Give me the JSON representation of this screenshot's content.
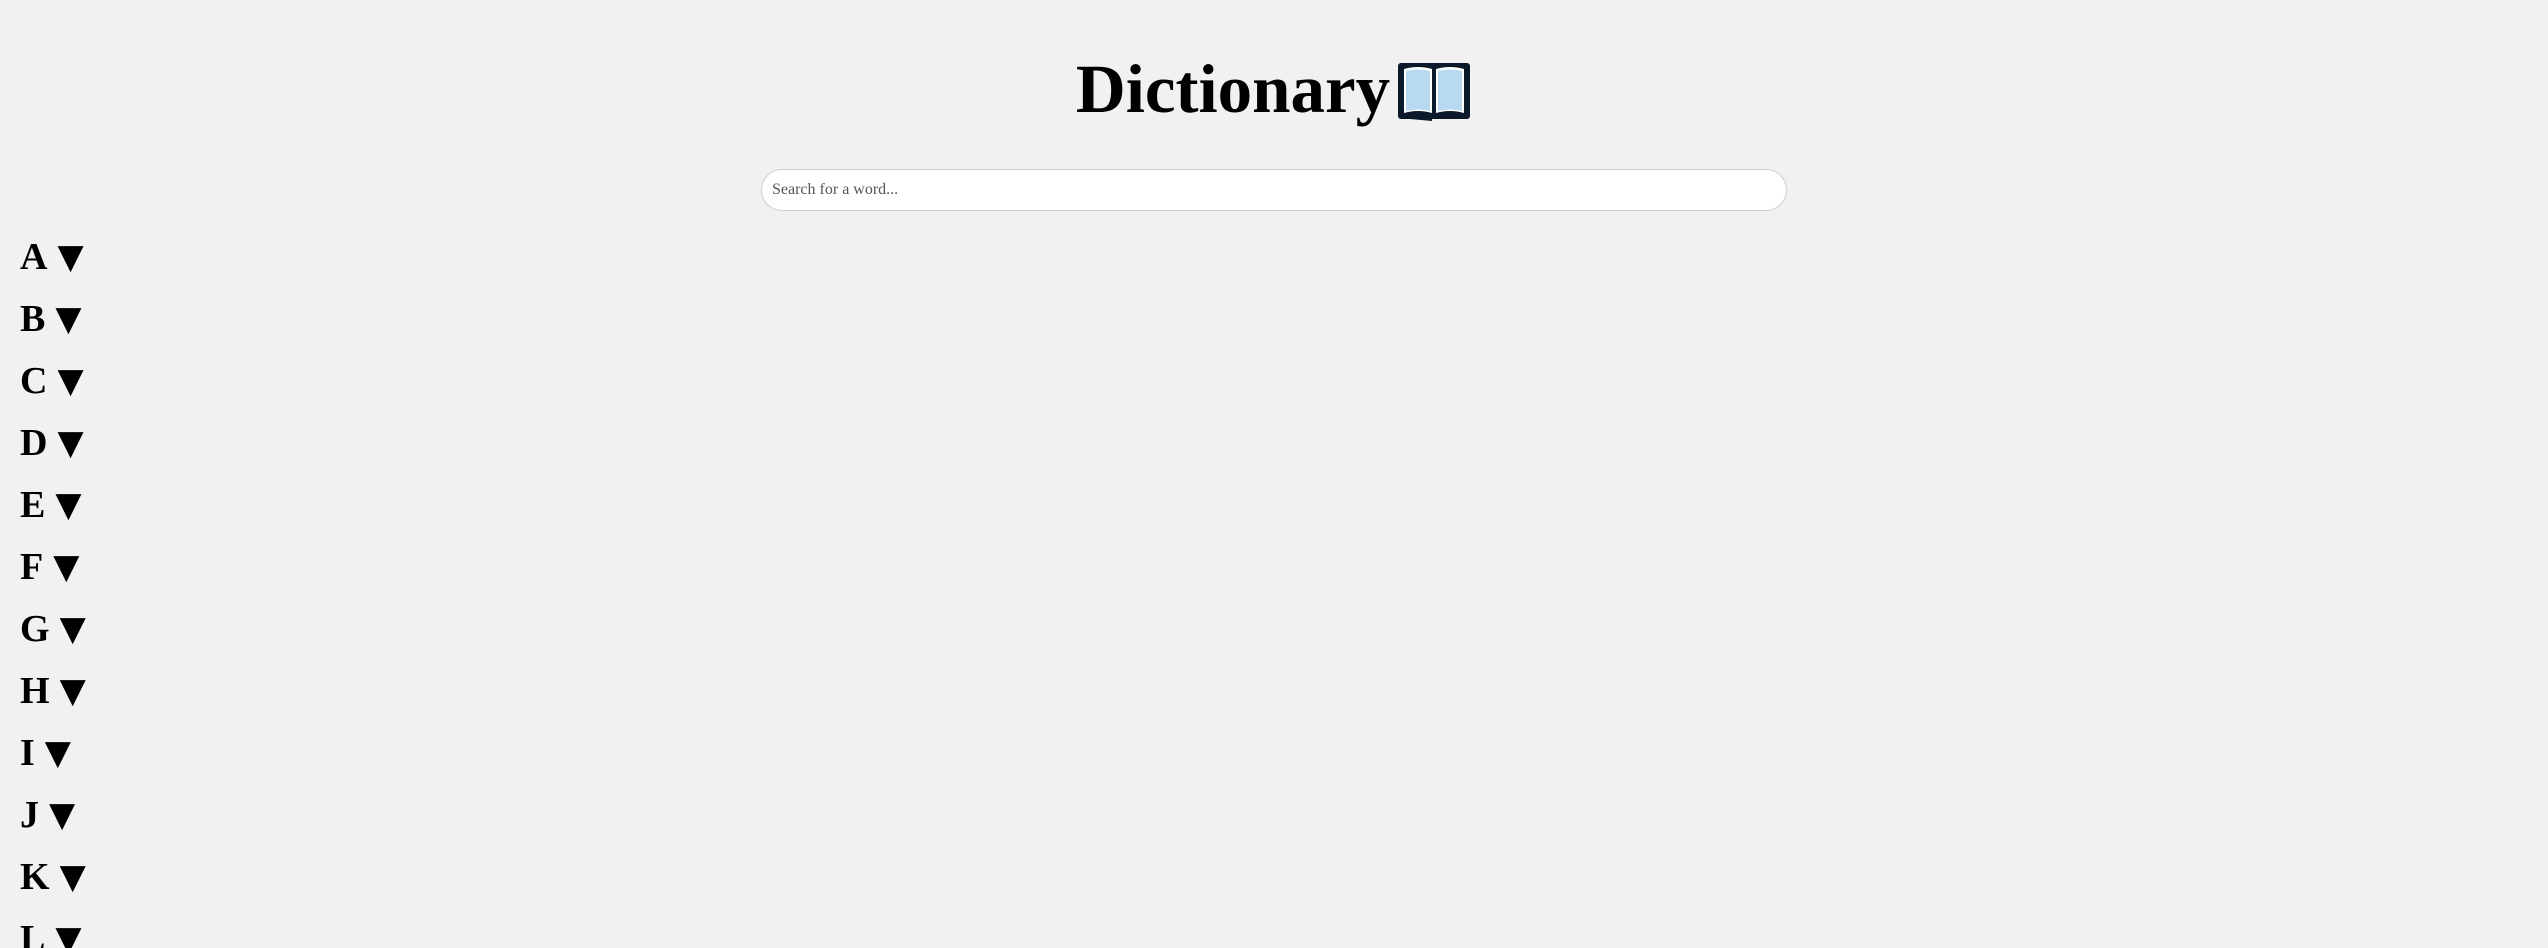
{
  "header": {
    "title": "Dictionary"
  },
  "search": {
    "placeholder": "Search for a word...",
    "value": ""
  },
  "letters": [
    {
      "label": "A",
      "icon": "▼"
    },
    {
      "label": "B",
      "icon": "▼"
    },
    {
      "label": "C",
      "icon": "▼"
    },
    {
      "label": "D",
      "icon": "▼"
    },
    {
      "label": "E",
      "icon": "▼"
    },
    {
      "label": "F",
      "icon": "▼"
    },
    {
      "label": "G",
      "icon": "▼"
    },
    {
      "label": "H",
      "icon": "▼"
    },
    {
      "label": "I",
      "icon": "▼"
    },
    {
      "label": "J",
      "icon": "▼"
    },
    {
      "label": "K",
      "icon": "▼"
    },
    {
      "label": "L",
      "icon": "▼"
    }
  ],
  "icons": {
    "title_icon": "open-book-icon",
    "letter_icon": "triangle-down-icon"
  },
  "colors": {
    "background": "#f1f1f1",
    "search_border": "#cfcfcf",
    "book_cover": "#0a1a2a",
    "book_pages": "#b9d9f0"
  }
}
